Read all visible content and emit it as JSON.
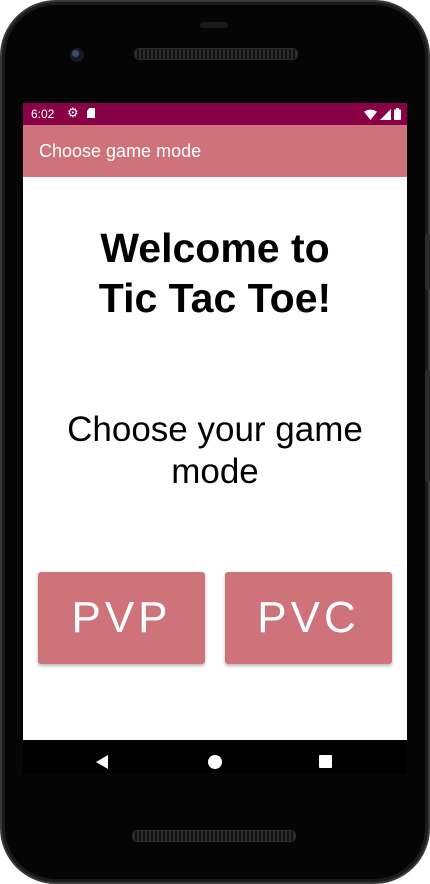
{
  "status_bar": {
    "time": "6:02",
    "left_icons": [
      "gear-icon",
      "sd-card-icon"
    ],
    "right_icons": [
      "wifi-icon",
      "signal-icon",
      "battery-icon"
    ],
    "background_color": "#880045"
  },
  "app_bar": {
    "title": "Choose game mode",
    "background_color": "#cf737a"
  },
  "main": {
    "welcome_line1": "Welcome to",
    "welcome_line2": "Tic Tac Toe!",
    "choose_line1": "Choose your game",
    "choose_line2": "mode",
    "buttons": [
      {
        "label": "PVP"
      },
      {
        "label": "PVC"
      }
    ],
    "button_color": "#cf737a"
  },
  "nav_bar": {
    "icons": [
      "back-icon",
      "home-icon",
      "recents-icon"
    ]
  }
}
